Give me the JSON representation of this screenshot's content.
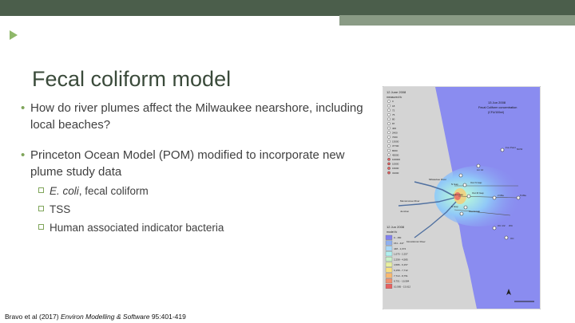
{
  "slide": {
    "title": "Fecal coliform model",
    "bullets": [
      {
        "text": "How do river plumes affect the Milwaukee nearshore, including local beaches?"
      },
      {
        "text": "Princeton Ocean Model (POM) modified to incorporate new plume study data",
        "sub": [
          "E. coli, fecal coliform",
          "TSS",
          "Human associated indicator bacteria"
        ]
      }
    ],
    "citation": {
      "authors": "Bravo et al (2017) ",
      "journal": "Environ Modelling & Software",
      "ref": " 95:401-419"
    }
  },
  "figure": {
    "date_top": "12 June 2008",
    "title_line1": "13 Jun 2008",
    "title_line2": "Fecal Coliform concentration",
    "title_line3": "(CFU/100ml)",
    "date_bottom": "12 Jun 2008",
    "legend_top_label": "measured fc",
    "legend_top_values": [
      "0",
      "18",
      "72",
      "75",
      "80",
      "87",
      "400",
      "2400",
      "7000",
      "13000",
      "37700",
      "8000",
      "45000",
      "100000",
      "10000",
      "16000",
      "31000"
    ],
    "legend_bottom_label": "model fc",
    "legend_bottom_values": [
      "0 - 150",
      "151 - 447",
      "448 - 1,074",
      "1,075 - 2,257",
      "2,258 - 4,585",
      "4,586 - 6,157",
      "6,158 - 7,712",
      "7,713 - 8,751",
      "8,751 - 10,584",
      "10,585 - 13,612"
    ],
    "legend_bottom_colors": [
      "#8080f0",
      "#8fb0f0",
      "#a8d8f8",
      "#b0f0f0",
      "#c8f0c8",
      "#e8f0a0",
      "#f8e080",
      "#f8b870",
      "#f09070",
      "#e86060"
    ],
    "place_labels": [
      "Milwaukee River",
      "Menomonee River",
      "Junction",
      "Kinnickinnic River",
      "N Gap",
      "Main Gap",
      "S Gap",
      "Out N Gap",
      "Out M Gap",
      "Out S Gap",
      "Lin 12",
      "2 Mile",
      "5 Mile",
      "Fox Point",
      "OC",
      "OC 1/2",
      "WC",
      "NCW"
    ],
    "colors": {
      "lake": "#8a8cf0",
      "land": "#d4d4d4"
    }
  }
}
